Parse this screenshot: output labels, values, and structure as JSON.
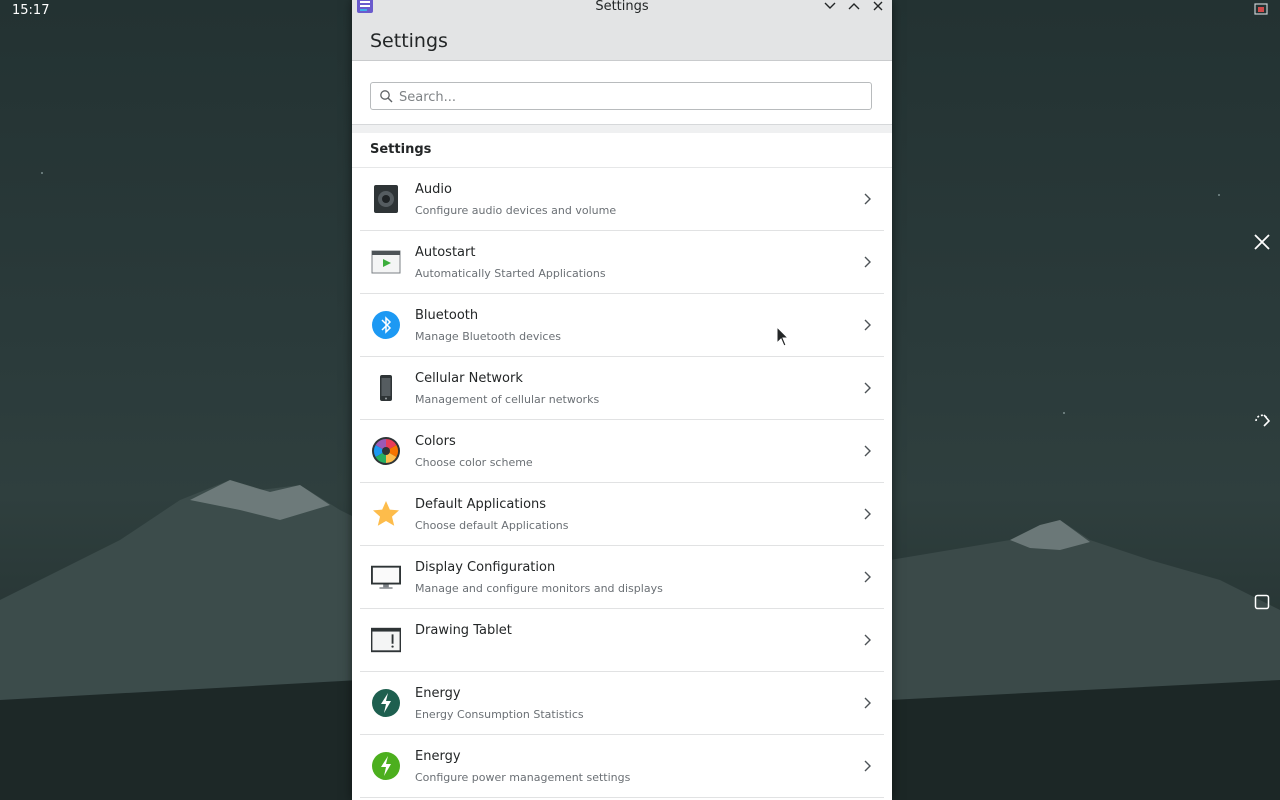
{
  "desktop": {
    "clock": "15:17"
  },
  "window": {
    "title": "Settings",
    "header_title": "Settings",
    "search": {
      "placeholder": "Search..."
    },
    "section_title": "Settings",
    "items": [
      {
        "name": "Audio",
        "desc": "Configure audio devices and volume",
        "icon": "speaker-icon"
      },
      {
        "name": "Autostart",
        "desc": "Automatically Started Applications",
        "icon": "autostart-icon"
      },
      {
        "name": "Bluetooth",
        "desc": "Manage Bluetooth devices",
        "icon": "bluetooth-icon"
      },
      {
        "name": "Cellular Network",
        "desc": "Management of cellular networks",
        "icon": "phone-icon"
      },
      {
        "name": "Colors",
        "desc": "Choose color scheme",
        "icon": "color-wheel-icon"
      },
      {
        "name": "Default Applications",
        "desc": "Choose default Applications",
        "icon": "star-icon"
      },
      {
        "name": "Display Configuration",
        "desc": "Manage and configure monitors and displays",
        "icon": "monitor-icon"
      },
      {
        "name": "Drawing Tablet",
        "desc": "",
        "icon": "tablet-icon"
      },
      {
        "name": "Energy",
        "desc": "Energy Consumption Statistics",
        "icon": "energy-stats-icon"
      },
      {
        "name": "Energy",
        "desc": "Configure power management settings",
        "icon": "power-icon"
      }
    ]
  },
  "colors": {
    "accent": "#3daee9",
    "window_bg": "#ffffff",
    "header_bg": "#e3e4e5",
    "text": "#232627",
    "subtext": "#6b7075"
  }
}
